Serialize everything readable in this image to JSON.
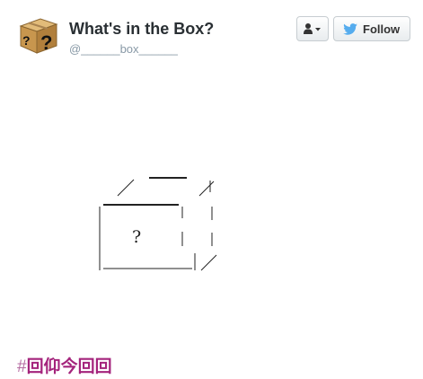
{
  "profile": {
    "display_name": "What's in the Box?",
    "handle": "@______box______"
  },
  "buttons": {
    "follow_label": "Follow",
    "user_dropdown_icon": "user-icon"
  },
  "tweet": {
    "box_mark": "?",
    "hashtag_symbol": "#",
    "hashtag_text": "回仰今回回"
  },
  "colors": {
    "twitter_blue": "#55acee",
    "hashtag": "#a4247c",
    "name_text": "#292f33",
    "handle_text": "#8899a6"
  }
}
